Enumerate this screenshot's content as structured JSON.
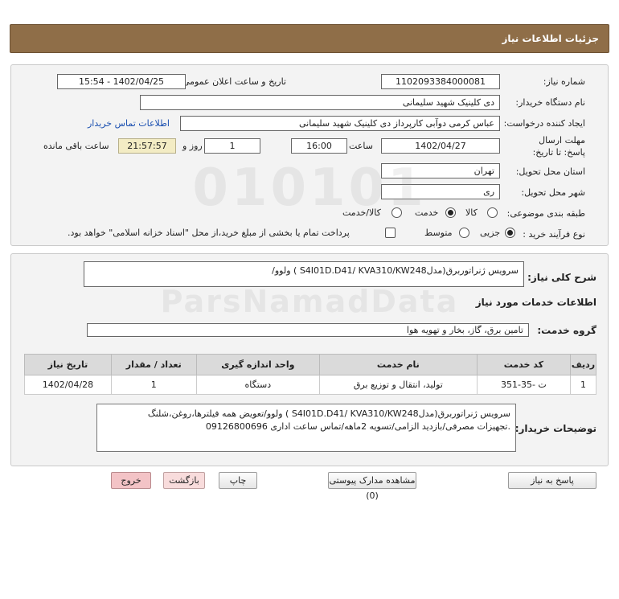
{
  "header": {
    "title": "جزئیات اطلاعات نیاز"
  },
  "form": {
    "need_number_label": "شماره نیاز:",
    "need_number": "1102093384000081",
    "announce_label": "تاریخ و ساعت اعلان عمومی:",
    "announce_value": "1402/04/25 - 15:54",
    "buyer_label": "نام دستگاه خریدار:",
    "buyer_value": "دی کلینیک شهید سلیمانی",
    "creator_label": "ایجاد کننده درخواست:",
    "creator_value": "عباس کرمی دوآبی کارپرداز دی کلینیک شهید سلیمانی",
    "contact_link": "اطلاعات تماس خریدار",
    "deadline_label": "مهلت ارسال پاسخ: تا تاریخ:",
    "deadline_date": "1402/04/27",
    "time_label": "ساعت",
    "deadline_time": "16:00",
    "days_value": "1",
    "days_label": "روز و",
    "remaining_time": "21:57:57",
    "remaining_label": "ساعت باقی مانده",
    "province_label": "استان محل تحویل:",
    "province_value": "تهران",
    "city_label": "شهر محل تحویل:",
    "city_value": "ری",
    "category_label": "طبقه بندی موضوعی:",
    "category_options": [
      "کالا",
      "خدمت",
      "کالا/خدمت"
    ],
    "purchase_type_label": "نوع فرآیند خرید :",
    "purchase_options": [
      "جزیی",
      "متوسط"
    ],
    "treasury_note": "پرداخت تمام یا بخشی از مبلغ خرید،از محل \"اسناد خزانه اسلامی\" خواهد بود."
  },
  "summary": {
    "label": "شرح کلی نیاز:",
    "value": "سرویس ژنراتوربرق(مدلS4I01D.D41/ KVA310/KW248 ) ولوو/"
  },
  "services": {
    "section_title": "اطلاعات خدمات مورد نیاز",
    "group_label": "گروه خدمت:",
    "group_value": "تامین برق، گاز، بخار و تهویه هوا",
    "columns": [
      "ردیف",
      "کد خدمت",
      "نام خدمت",
      "واحد اندازه گیری",
      "تعداد / مقدار",
      "تاریخ نیاز"
    ],
    "rows": [
      [
        "1",
        "ت -35-351",
        "تولید، انتقال و توزیع برق",
        "دستگاه",
        "1",
        "1402/04/28"
      ]
    ]
  },
  "buyer_notes": {
    "label": "توضیحات خریدار:",
    "line1": "سرویس ژنراتوربرق(مدلS4I01D.D41/ KVA310/KW248 ) ولوو/تعویض همه فیلترها،روغن،شلنگ",
    "line2": ".تجهیزات مصرفی/بازدید الزامی/تسویه 2ماهه/تماس ساعت اداری 09126800696"
  },
  "buttons": {
    "reply": "پاسخ به نیاز",
    "attachments": "مشاهده مدارک پیوستی (0)",
    "print": "چاپ",
    "back": "بازگشت",
    "exit": "خروج"
  },
  "watermark": {
    "number": "010101",
    "brand": "ParsNamadData"
  }
}
